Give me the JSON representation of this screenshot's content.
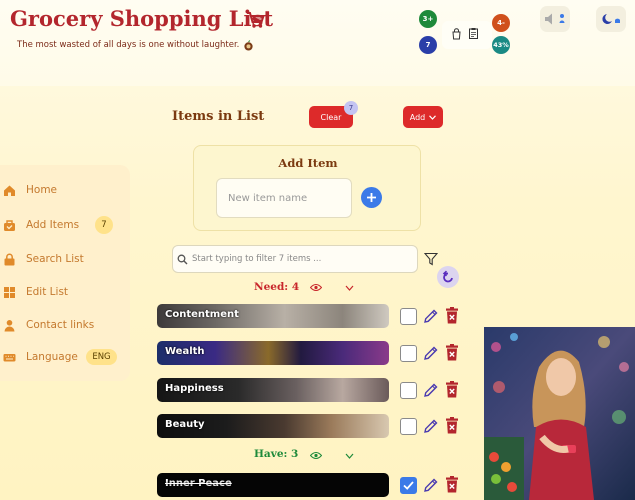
{
  "header": {
    "title": "Grocery Shopping List",
    "tagline": "The most wasted of all days is one without laughter.",
    "stats": {
      "need_count": "3+",
      "items_count": "7",
      "pending_count": "4-",
      "progress": "43%"
    },
    "colors": {
      "title": "#b3262d",
      "green": "#1e8a3a",
      "navy": "#2a3ea8",
      "orange": "#d0501c",
      "teal": "#1a8a84"
    },
    "icons": [
      "cart-icon",
      "coconut-icon",
      "bag-icon",
      "clipboard-icon",
      "speaker-icon",
      "person-icon",
      "moon-icon"
    ]
  },
  "sidebar": {
    "items": [
      {
        "label": "Home",
        "icon": "home-icon"
      },
      {
        "label": "Add Items",
        "icon": "basket-icon",
        "badge": "7"
      },
      {
        "label": "Search List",
        "icon": "lock-icon"
      },
      {
        "label": "Edit List",
        "icon": "grid-icon"
      },
      {
        "label": "Contact links",
        "icon": "person-icon"
      },
      {
        "label": "Language",
        "icon": "keyboard-icon",
        "badge": "ENG"
      }
    ]
  },
  "main": {
    "section_title": "Items in List",
    "clear_label": "Clear",
    "clear_badge": "7",
    "add_label": "Add",
    "add_item": {
      "title": "Add Item",
      "placeholder": "New item name"
    },
    "filter_placeholder": "Start typing to filter 7 items ...",
    "need": {
      "label": "Need: 4",
      "items": [
        "Contentment",
        "Wealth",
        "Happiness",
        "Beauty"
      ]
    },
    "have": {
      "label": "Have: 3",
      "items": [
        "Inner Peace"
      ]
    }
  }
}
